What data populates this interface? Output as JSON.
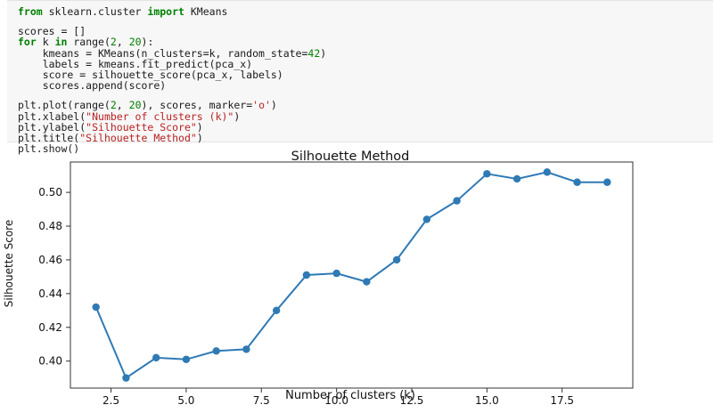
{
  "code": {
    "lines": [
      [
        {
          "t": "from",
          "c": "kw"
        },
        {
          "t": " sklearn.cluster "
        },
        {
          "t": "import",
          "c": "kw"
        },
        {
          "t": " KMeans"
        }
      ],
      [],
      [
        {
          "t": "scores = []"
        }
      ],
      [
        {
          "t": "for",
          "c": "kw"
        },
        {
          "t": " k "
        },
        {
          "t": "in",
          "c": "kw"
        },
        {
          "t": " range("
        },
        {
          "t": "2",
          "c": "num"
        },
        {
          "t": ", "
        },
        {
          "t": "20",
          "c": "num"
        },
        {
          "t": "):"
        }
      ],
      [
        {
          "t": "    kmeans = KMeans(n_clusters=k, random_state="
        },
        {
          "t": "42",
          "c": "num"
        },
        {
          "t": ")"
        }
      ],
      [
        {
          "t": "    labels = kmeans.fit_predict(pca_x)"
        }
      ],
      [
        {
          "t": "    score = silhouette_score(pca_x, labels)"
        }
      ],
      [
        {
          "t": "    scores.append(score)"
        }
      ],
      [],
      [
        {
          "t": "plt.plot(range("
        },
        {
          "t": "2",
          "c": "num"
        },
        {
          "t": ", "
        },
        {
          "t": "20",
          "c": "num"
        },
        {
          "t": "), scores, marker="
        },
        {
          "t": "'o'",
          "c": "str"
        },
        {
          "t": ")"
        }
      ],
      [
        {
          "t": "plt.xlabel("
        },
        {
          "t": "\"Number of clusters (k)\"",
          "c": "str"
        },
        {
          "t": ")"
        }
      ],
      [
        {
          "t": "plt.ylabel("
        },
        {
          "t": "\"Silhouette Score\"",
          "c": "str"
        },
        {
          "t": ")"
        }
      ],
      [
        {
          "t": "plt.title("
        },
        {
          "t": "\"Silhouette Method\"",
          "c": "str"
        },
        {
          "t": ")"
        }
      ],
      [
        {
          "t": "plt.show()"
        }
      ]
    ]
  },
  "chart_data": {
    "type": "line",
    "title": "Silhouette Method",
    "xlabel": "Number of clusters (k)",
    "ylabel": "Silhouette Score",
    "x": [
      2,
      3,
      4,
      5,
      6,
      7,
      8,
      9,
      10,
      11,
      12,
      13,
      14,
      15,
      16,
      17,
      18,
      19
    ],
    "y": [
      0.432,
      0.39,
      0.402,
      0.401,
      0.406,
      0.407,
      0.43,
      0.451,
      0.452,
      0.447,
      0.46,
      0.484,
      0.495,
      0.511,
      0.508,
      0.512,
      0.506,
      0.506
    ],
    "xlim": [
      1.15,
      19.85
    ],
    "ylim": [
      0.384,
      0.518
    ],
    "xticks": [
      2.5,
      5.0,
      7.5,
      10.0,
      12.5,
      15.0,
      17.5
    ],
    "xtick_labels": [
      "2.5",
      "5.0",
      "7.5",
      "10.0",
      "12.5",
      "15.0",
      "17.5"
    ],
    "yticks": [
      0.4,
      0.42,
      0.44,
      0.46,
      0.48,
      0.5
    ],
    "ytick_labels": [
      "0.40",
      "0.42",
      "0.44",
      "0.46",
      "0.48",
      "0.50"
    ],
    "color": "#2f7ab5",
    "marker": "o",
    "grid": false,
    "legend": "none"
  }
}
